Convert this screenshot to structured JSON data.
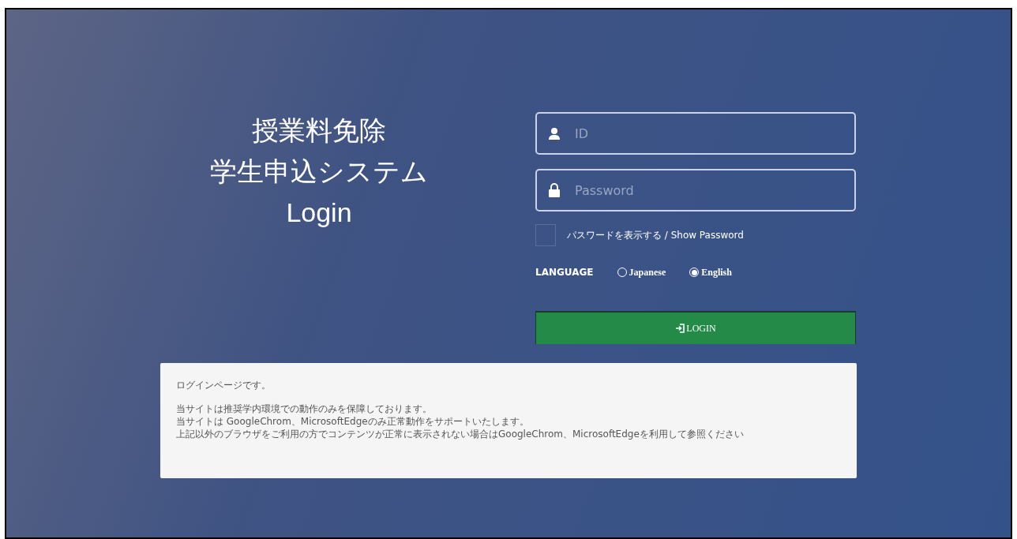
{
  "title_lines": [
    "授業料免除",
    "学生申込システム",
    "Login"
  ],
  "id_field": {
    "placeholder": "ID"
  },
  "password_field": {
    "placeholder": "Password"
  },
  "show_password": {
    "label": "パスワードを表示する / Show Password",
    "checked": false
  },
  "language": {
    "label": "LANGUAGE",
    "options": [
      {
        "label": "Japanese",
        "selected": false
      },
      {
        "label": "English",
        "selected": true
      }
    ]
  },
  "login_button": {
    "label": "LOGIN"
  },
  "notice": {
    "heading": "ログインページです。",
    "lines": [
      "当サイトは推奨学内環境での動作のみを保障しております。",
      "当サイトは GoogleChrom、MicrosoftEdgeのみ正常動作をサポートいたします。",
      "上記以外のブラウザをご利用の方でコンテンツが正常に表示されない場合はGoogleChrom、MicrosoftEdgeを利用して参照ください"
    ]
  }
}
